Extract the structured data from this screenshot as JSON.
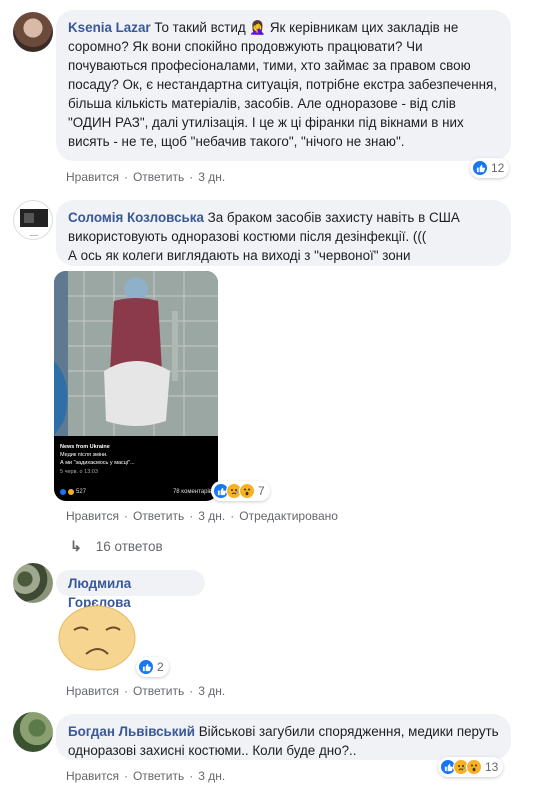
{
  "comments": [
    {
      "author": "Ksenia Lazar",
      "text": "То такий встид 🤦‍♀️ Як керівникам цих закладів не соромно? Як вони спокійно продовжують працювати? Чи почуваються професіоналами, тими, хто займає за правом свою посаду? Ок, є нестандартна ситуація, потрібне екстра забезпечення, більша кількість матеріалів, засобів. Але одноразове - від слів \"ОДИН РАЗ\", далі утилізація. І це ж ці фіранки під вікнами в них висять - не те, щоб \"небачив такого\", \"нічого не знаю\".",
      "reaction_count": "12",
      "like_label": "Нравится",
      "reply_label": "Ответить",
      "time": "3 дн."
    },
    {
      "author": "Соломія Козловська",
      "text": "За браком засобів захисту навіть в США використовують одноразові костюми після дезінфекції. (((\nА ось як колеги виглядають на виході з \"червоної\" зони",
      "image": {
        "source": "News from Ukraine",
        "caption_line1": "Медик після зміни.",
        "caption_line2": "А ми \"задихаємось у масці\"...",
        "date": "5 черв. о 13:03",
        "reactions": "527",
        "comments": "78 коментарів"
      },
      "reaction_count": "7",
      "like_label": "Нравится",
      "reply_label": "Ответить",
      "time": "3 дн.",
      "edited": "Отредактировано",
      "replies": "16 ответов"
    },
    {
      "author": "Людмила Горєлова",
      "reaction_count": "2",
      "like_label": "Нравится",
      "reply_label": "Ответить",
      "time": "3 дн."
    },
    {
      "author": "Богдан Львівський",
      "text": "Військові загубили спорядження, медики перуть одноразові захисні костюми.. Коли буде дно?..",
      "reaction_count": "13",
      "like_label": "Нравится",
      "reply_label": "Ответить",
      "time": "3 дн."
    }
  ],
  "colors": {
    "author": "#385898",
    "bubble": "#f0f2f5",
    "meta": "#65676b",
    "like": "#1877f2"
  }
}
